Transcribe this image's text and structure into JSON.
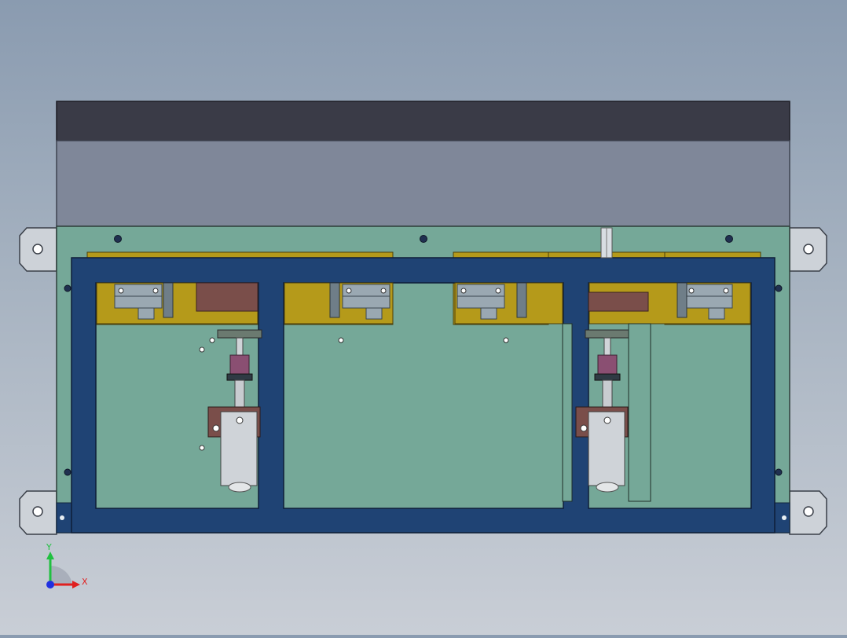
{
  "view": {
    "background_top": "#8a9bb0",
    "background_bottom": "#c9ced6"
  },
  "triad": {
    "x_label": "X",
    "y_label": "Y",
    "x_color": "#e02020",
    "y_color": "#20c040",
    "z_color": "#2030e0"
  },
  "colors": {
    "hood_dark": "#3a3b47",
    "hood_panel": "#7f8799",
    "base_plate": "#75a898",
    "frame": "#1f4374",
    "rail": "#b59a1a",
    "slide_block": "#9aa8b2",
    "cylinder_body": "#cfd3d8",
    "bellows": "#8a4f72",
    "bracket": "#7a4e4a",
    "mounting_ear": "#cdd2d8"
  }
}
